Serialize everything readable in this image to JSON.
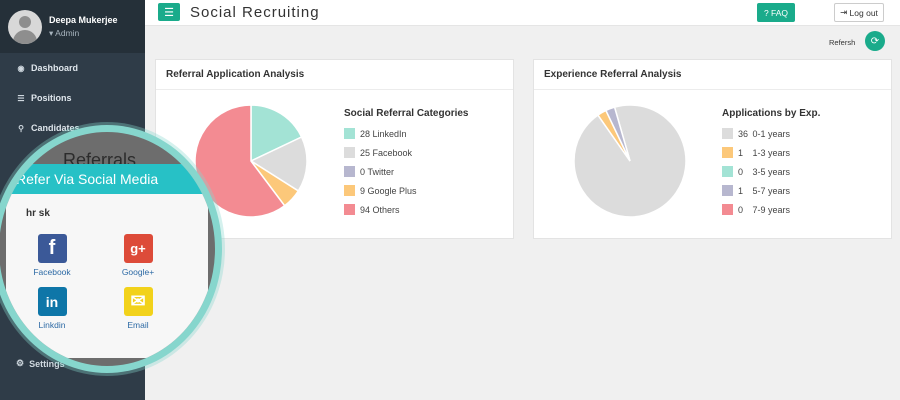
{
  "profile": {
    "name": "Deepa Mukerjee",
    "role": "Admin"
  },
  "sidebar": {
    "items": [
      {
        "label": "Dashboard",
        "icon": "dashboard-icon"
      },
      {
        "label": "Positions",
        "icon": "list-icon"
      },
      {
        "label": "Candidates",
        "icon": "search-icon"
      }
    ],
    "partial_item": "Referrals",
    "settings": "Settings"
  },
  "header": {
    "title": "Social Recruiting",
    "faq": "FAQ",
    "logout": "Log out"
  },
  "refresh": {
    "label": "Refersh"
  },
  "panels": {
    "referral": {
      "title": "Referral Application Analysis",
      "legend_title": "Social Referral Categories",
      "items": [
        {
          "count": "28",
          "label": "LinkedIn",
          "value": 28,
          "color": "#a3e3d5"
        },
        {
          "count": "25",
          "label": "Facebook",
          "value": 25,
          "color": "#dcdcdc"
        },
        {
          "count": "0",
          "label": "Twitter",
          "value": 0,
          "color": "#b7b7cf"
        },
        {
          "count": "9",
          "label": "Google Plus",
          "value": 9,
          "color": "#fcc87a"
        },
        {
          "count": "94",
          "label": "Others",
          "value": 94,
          "color": "#f38b92"
        }
      ]
    },
    "experience": {
      "title": "Experience Referral Analysis",
      "legend_title": "Applications by Exp.",
      "items": [
        {
          "count": "36",
          "label": "0-1 years",
          "value": 36,
          "color": "#dcdcdc"
        },
        {
          "count": "1",
          "label": "1-3 years",
          "value": 1,
          "color": "#fcc87a"
        },
        {
          "count": "0",
          "label": "3-5 years",
          "value": 0,
          "color": "#a3e3d5"
        },
        {
          "count": "1",
          "label": "5-7 years",
          "value": 1,
          "color": "#b7b7cf"
        },
        {
          "count": "0",
          "label": "7-9 years",
          "value": 0,
          "color": "#f38b92"
        }
      ]
    }
  },
  "refer": {
    "title": "Refer Via Social Media",
    "user": "hr sk",
    "networks": [
      {
        "label": "Facebook",
        "icon": "facebook-icon",
        "glyph": "f",
        "color": "#3b5998"
      },
      {
        "label": "Google+",
        "icon": "google-plus-icon",
        "glyph": "g+",
        "color": "#dd4b39"
      },
      {
        "label": "Linkdin",
        "icon": "linkedin-icon",
        "glyph": "in",
        "color": "#0e76a8"
      },
      {
        "label": "Email",
        "icon": "email-icon",
        "glyph": "✉",
        "color": "#f2d21b"
      }
    ]
  }
}
